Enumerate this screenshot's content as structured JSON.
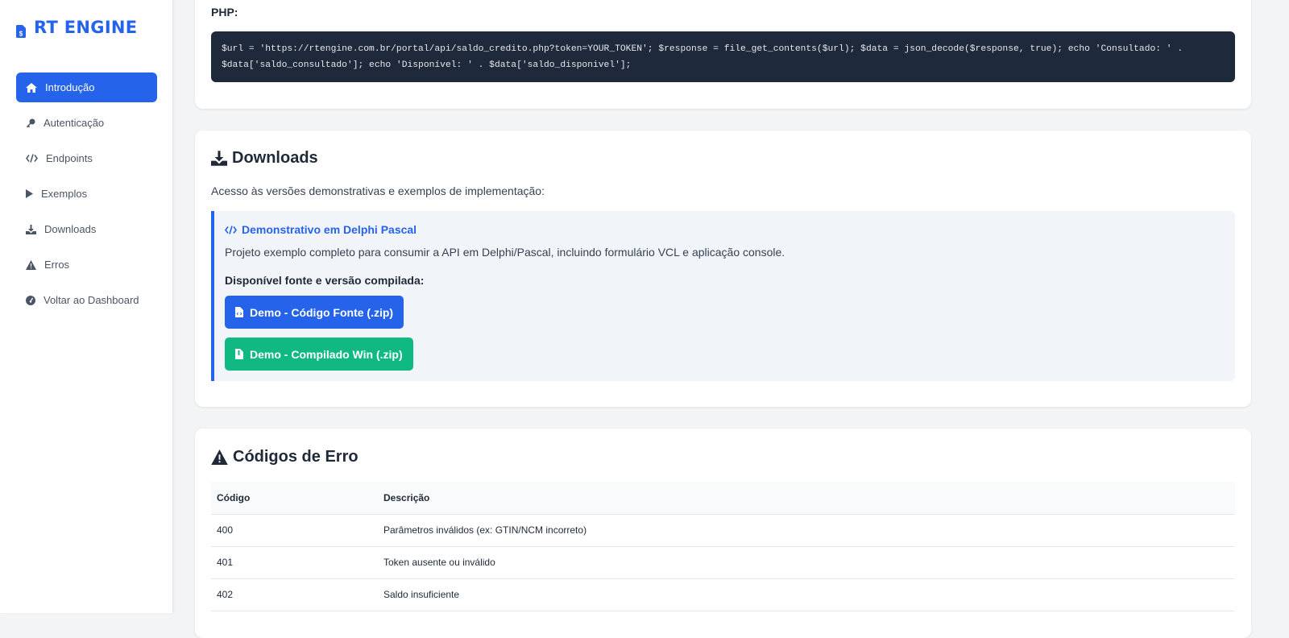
{
  "brand": {
    "name": "RT ENGINE",
    "color": "#2563eb"
  },
  "sidebar": {
    "items": [
      {
        "label": "Introdução",
        "icon": "home-icon",
        "active": true
      },
      {
        "label": "Autenticação",
        "icon": "key-icon"
      },
      {
        "label": "Endpoints",
        "icon": "code-icon"
      },
      {
        "label": "Exemplos",
        "icon": "play-icon"
      },
      {
        "label": "Downloads",
        "icon": "download-icon"
      },
      {
        "label": "Erros",
        "icon": "warning-icon"
      },
      {
        "label": "Voltar ao Dashboard",
        "icon": "dashboard-icon"
      }
    ]
  },
  "php": {
    "label": "PHP:",
    "code_line1": "$url = 'https://rtengine.com.br/portal/api/saldo_credito.php?token=YOUR_TOKEN'; $response = file_get_contents($url); $data = json_decode($response, true); echo 'Consultado: ' .",
    "code_line2": "$data['saldo_consultado']; echo 'Disponível: ' . $data['saldo_disponivel'];"
  },
  "downloads": {
    "title": "Downloads",
    "intro": "Acesso às versões demonstrativas e exemplos de implementação:",
    "box_title": "Demonstrativo em Delphi Pascal",
    "box_desc": "Projeto exemplo completo para consumir a API em Delphi/Pascal, incluindo formulário VCL e aplicação console.",
    "box_sub": "Disponível fonte e versão compilada:",
    "btn_source": "Demo - Código Fonte (.zip)",
    "btn_compiled": "Demo - Compilado Win (.zip)",
    "btn_source_color": "#2563eb",
    "btn_compiled_color": "#10b981"
  },
  "errors": {
    "title": "Códigos de Erro",
    "headers": [
      "Código",
      "Descrição"
    ],
    "rows": [
      [
        "400",
        "Parâmetros inválidos (ex: GTIN/NCM incorreto)"
      ],
      [
        "401",
        "Token ausente ou inválido"
      ],
      [
        "402",
        "Saldo insuficiente"
      ]
    ]
  }
}
